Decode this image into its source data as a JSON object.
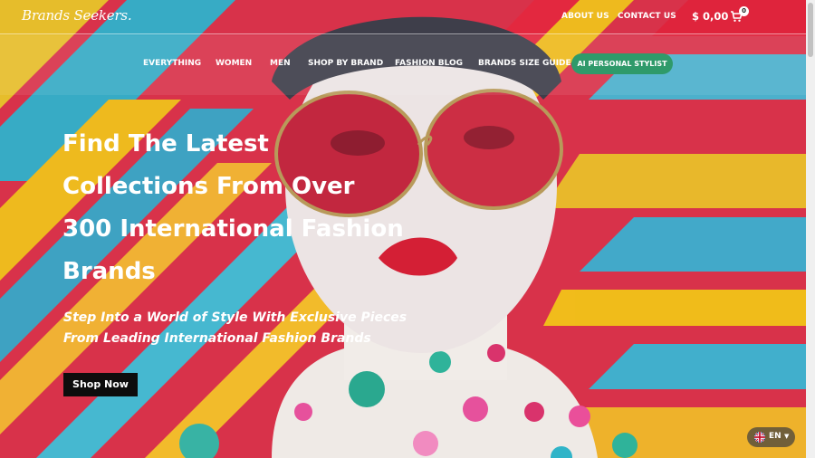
{
  "header": {
    "logo": "Brands Seekers.",
    "links": [
      "ABOUT US",
      "CONTACT US"
    ],
    "price": "$ 0,00",
    "cart_count": "0"
  },
  "nav": {
    "items": [
      "EVERYTHING",
      "WOMEN",
      "MEN",
      "SHOP BY BRAND",
      "FASHION BLOG",
      "BRANDS SIZE GUIDE"
    ],
    "stylist_label": "AI PERSONAL STYLIST"
  },
  "hero": {
    "headline_lines": [
      "Find The Latest",
      "Collections From Over",
      "300 International Fashion",
      "Brands"
    ],
    "subhead_lines": [
      "Step Into a World of Style With Exclusive Pieces",
      "From Leading International Fashion Brands"
    ],
    "cta": "Shop Now"
  },
  "language": {
    "label": "EN"
  },
  "colors": {
    "stylist_button": "#2f9a6a",
    "cta_background": "#0d0d0d",
    "pattern_red": "#e0243c",
    "pattern_yellow": "#f2c418",
    "pattern_cyan": "#3fb8d6"
  },
  "icons": [
    "cart-icon",
    "uk-flag-icon",
    "caret-down-icon"
  ]
}
